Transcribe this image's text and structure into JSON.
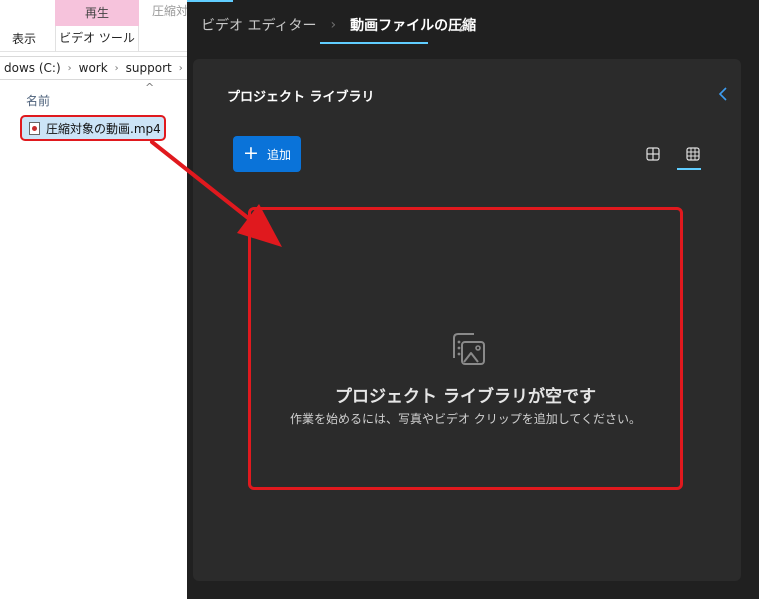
{
  "explorer": {
    "ribbon": {
      "context_tab_header": "再生",
      "context_tab_second": "圧縮対",
      "tab_view": "表示",
      "tab_video_tools": "ビデオ ツール"
    },
    "address": [
      "dows (C:)",
      "work",
      "support"
    ],
    "column_header": "名前",
    "file": {
      "name": "圧縮対象の動画.mp4"
    }
  },
  "editor": {
    "breadcrumb": {
      "root": "ビデオ エディター",
      "current": "動画ファイルの圧縮"
    },
    "icons": {
      "rename": "pencil-icon",
      "collapse": "chevron-left-icon",
      "view_large": "large-grid-icon",
      "view_small": "small-grid-icon",
      "empty_media": "media-library-icon"
    },
    "library": {
      "title": "プロジェクト ライブラリ",
      "add_button": {
        "label": "追加"
      },
      "empty_title": "プロジェクト ライブラリが空です",
      "empty_desc": "作業を始めるには、写真やビデオ クリップを追加してください。"
    }
  },
  "colors": {
    "accent": "#60cdff",
    "button": "#0a73d9",
    "highlight": "#e0191e",
    "context_tab": "#f6c3dc"
  }
}
